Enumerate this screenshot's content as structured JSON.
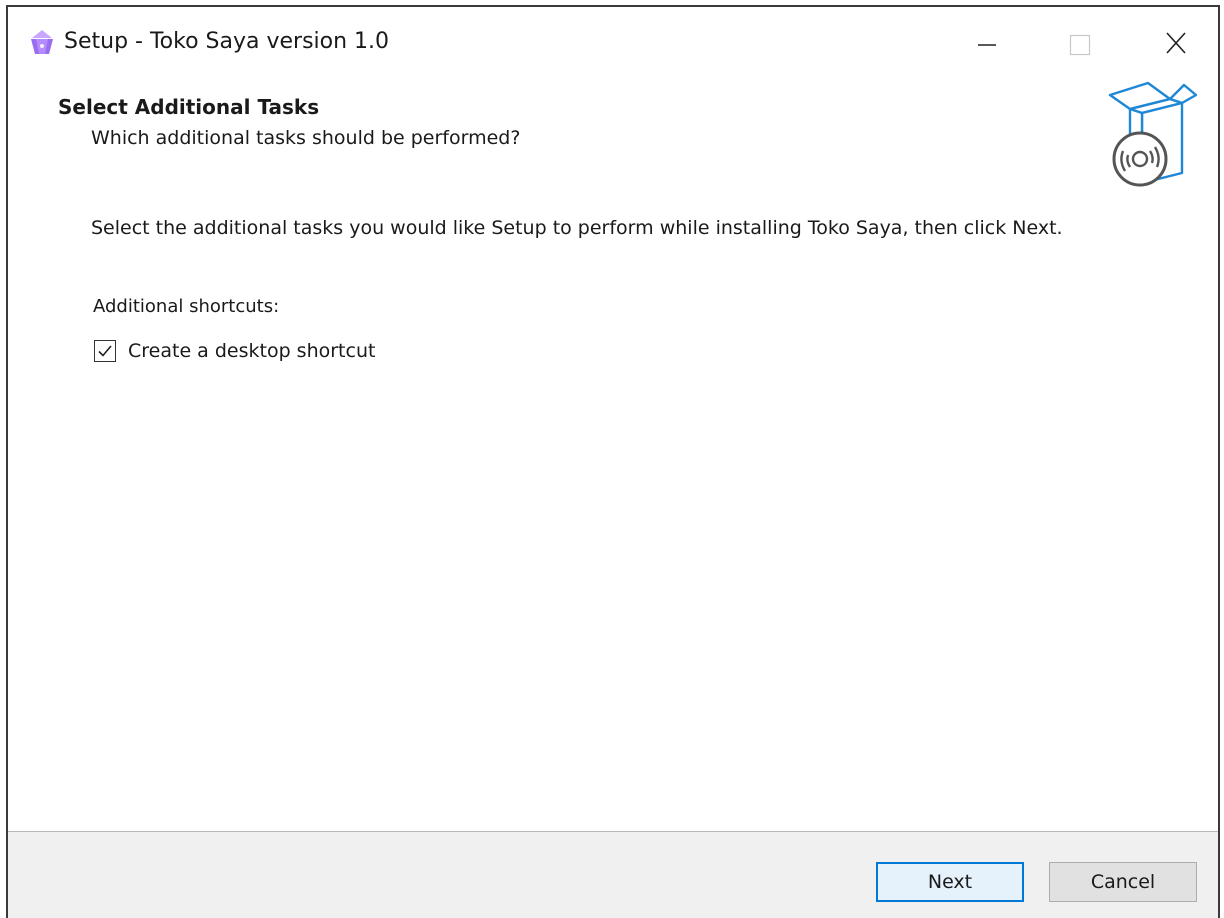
{
  "window": {
    "title": "Setup - Toko Saya version 1.0"
  },
  "header": {
    "title": "Select Additional Tasks",
    "subtitle": "Which additional tasks should be performed?"
  },
  "body": {
    "instruction": "Select the additional tasks you would like Setup to perform while installing Toko Saya, then click Next.",
    "group_label": "Additional shortcuts:",
    "tasks": [
      {
        "label": "Create a desktop shortcut",
        "checked": true
      }
    ]
  },
  "buttons": {
    "next": "Next",
    "cancel": "Cancel"
  },
  "icons": {
    "app": "app-icon",
    "wizard": "software-box-icon",
    "minimize": "minimize-icon",
    "maximize": "maximize-icon",
    "close": "close-icon",
    "check": "checkmark-icon"
  },
  "colors": {
    "accent": "#0078d7",
    "footer_bg": "#f0f0f0",
    "box_blue": "#1e88d6",
    "app_purple": "#9a6cf0"
  }
}
